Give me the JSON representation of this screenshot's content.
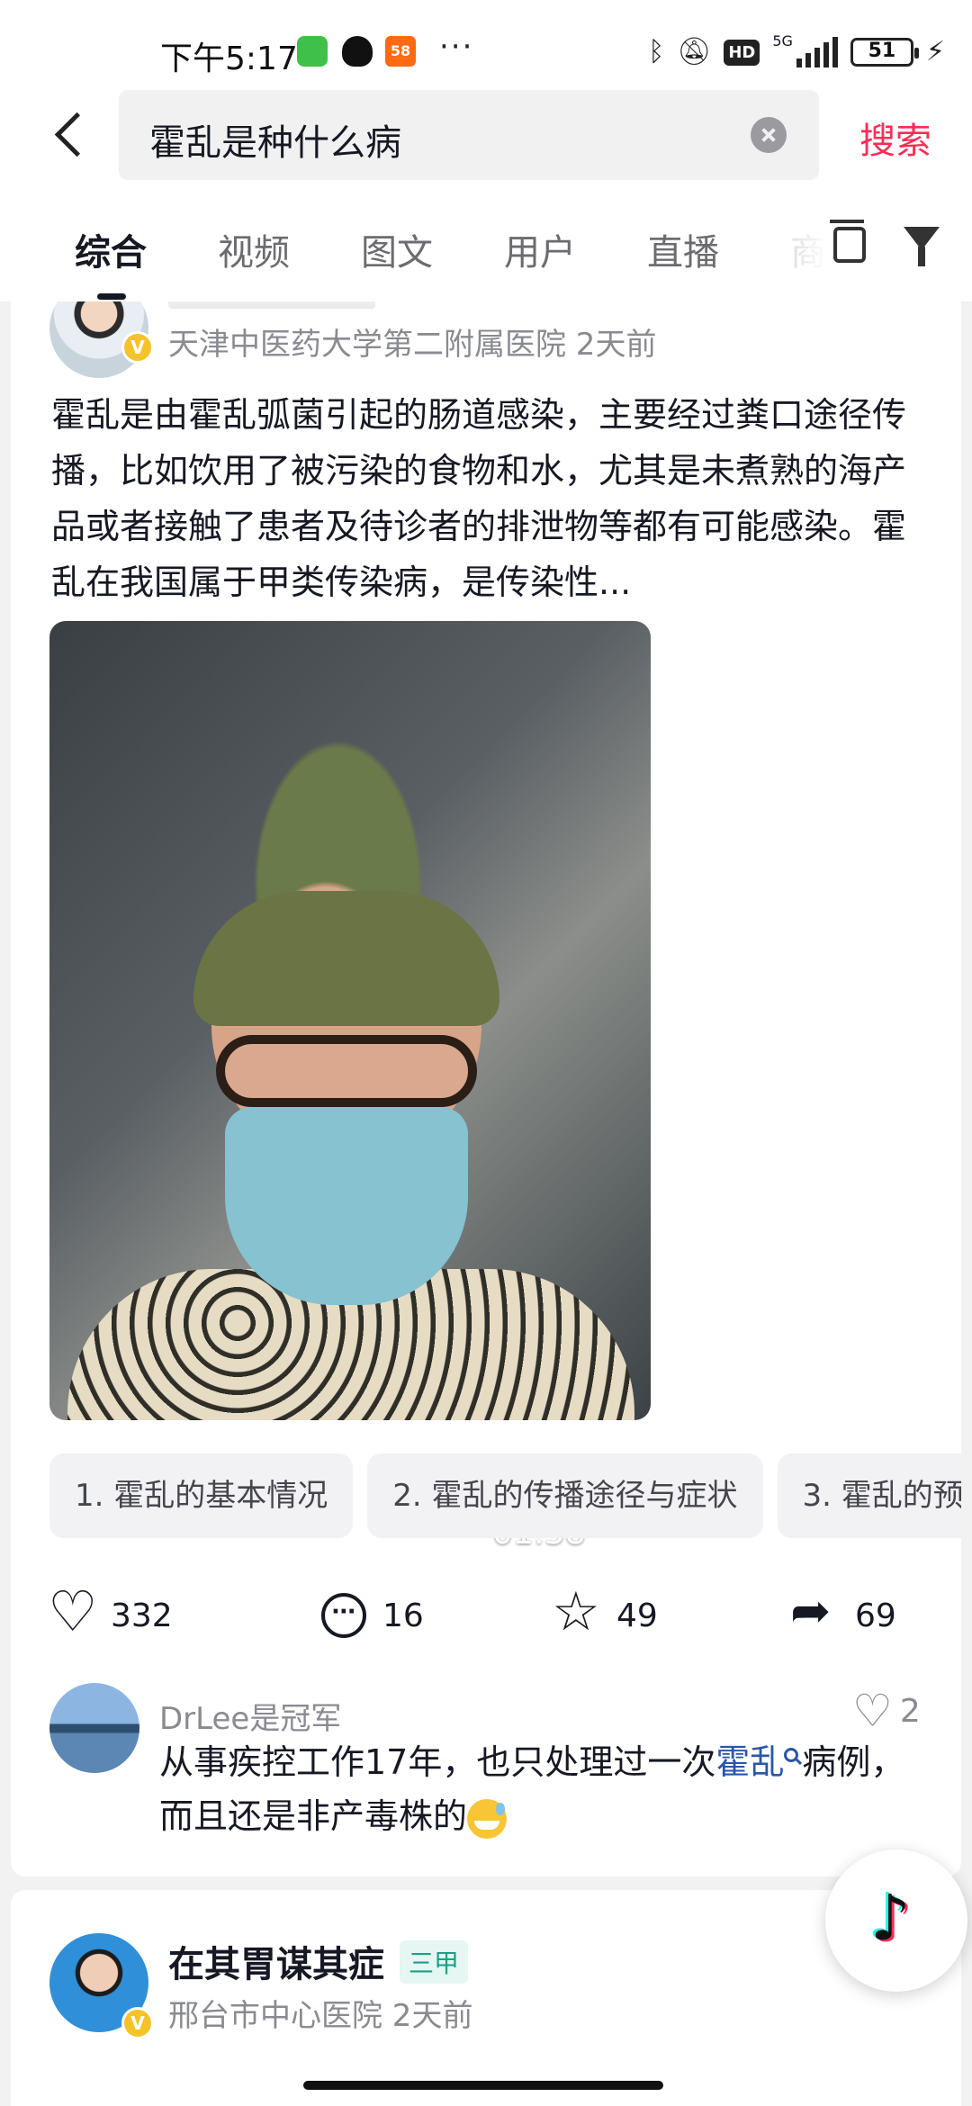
{
  "status_bar": {
    "time": "下午5:17",
    "app58": "58",
    "more": "···",
    "network": "5G",
    "hd": "HD",
    "battery": "51",
    "battery_level": 0.51
  },
  "search": {
    "query": "霍乱是种什么病",
    "search_button": "搜索"
  },
  "tabs": [
    "综合",
    "视频",
    "图文",
    "用户",
    "直播",
    "商"
  ],
  "active_tab": 0,
  "result1": {
    "source": "天津中医药大学第二附属医院 2天前",
    "verified_mark": "V",
    "description": "霍乱是由霍乱弧菌引起的肠道感染，主要经过粪口途径传播，比如饮用了被污染的食物和水，尤其是未煮熟的海产品或者接触了患者及待诊者的排泄物等都有可能感染。霍乱在我国属于甲类传染病，是传染性...",
    "video_duration": "01:58",
    "chapters": [
      "1. 霍乱的基本情况",
      "2. 霍乱的传播途径与症状",
      "3. 霍乱的预"
    ],
    "likes": "332",
    "comments": "16",
    "favorites": "49",
    "shares": "69",
    "top_comment": {
      "user": "DrLee是冠军",
      "likes": "2",
      "text_before": "从事疾控工作17年，也只处理过一次",
      "link_text": "霍乱",
      "text_after": "病例，而且还是非产毒株的"
    }
  },
  "result2": {
    "author": "在其胃谋其症",
    "badge": "三甲",
    "source": "邢台市中心医院 2天前",
    "verified_mark": "V"
  },
  "colors": {
    "accent": "#fe2c55",
    "link": "#2a55a9",
    "badge": "#1aa08a"
  }
}
